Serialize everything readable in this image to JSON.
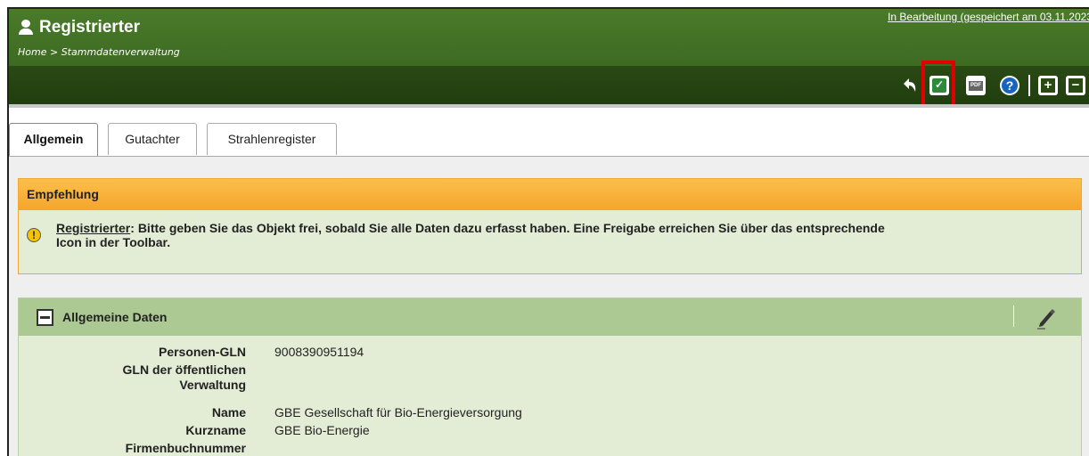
{
  "header": {
    "title": "Registrierter",
    "breadcrumb": "Home > Stammdatenverwaltung",
    "status": "In Bearbeitung (gespeichert am 03.11.2023",
    "section_symbol": "§"
  },
  "toolbar": {
    "help_symbol": "?",
    "pdf_symbol": "PDF",
    "expand_symbol": "+",
    "collapse_symbol": "−"
  },
  "tabs": [
    {
      "label": "Allgemein",
      "active": true
    },
    {
      "label": "Gutachter",
      "active": false
    },
    {
      "label": "Strahlenregister",
      "active": false
    }
  ],
  "empfehlung": {
    "heading": "Empfehlung",
    "warn_symbol": "!",
    "link": "Registrierter",
    "text_line1": ": Bitte geben Sie das Objekt frei, sobald Sie alle Daten dazu erfasst haben. Eine Freigabe erreichen Sie über das entsprechende",
    "text_line2": "Icon in der Toolbar."
  },
  "allgemeine_daten": {
    "heading": "Allgemeine Daten",
    "fields": [
      {
        "label": "Personen-GLN",
        "value": "9008390951194"
      },
      {
        "label": "GLN der öffentlichen",
        "label2": "Verwaltung",
        "value": ""
      },
      {
        "label": "Name",
        "value": "GBE Gesellschaft für Bio-Energieversorgung"
      },
      {
        "label": "Kurzname",
        "value": "GBE Bio-Energie"
      },
      {
        "label": "Firmenbuchnummer",
        "value": ""
      }
    ]
  },
  "colors": {
    "header_green": "#4a7a2a",
    "toolbar_dark_green": "#2a4a14",
    "highlight_red": "#e00000",
    "panel_orange": "#f6a52d",
    "panel_green_bg": "#e3edd6",
    "panel_green_head": "#acc993"
  },
  "icons": [
    "person-icon",
    "section-icon",
    "back-icon",
    "release-icon",
    "pdf-icon",
    "help-icon",
    "expand-all-icon",
    "collapse-all-icon",
    "warning-icon",
    "collapse-icon",
    "pencil-icon"
  ]
}
